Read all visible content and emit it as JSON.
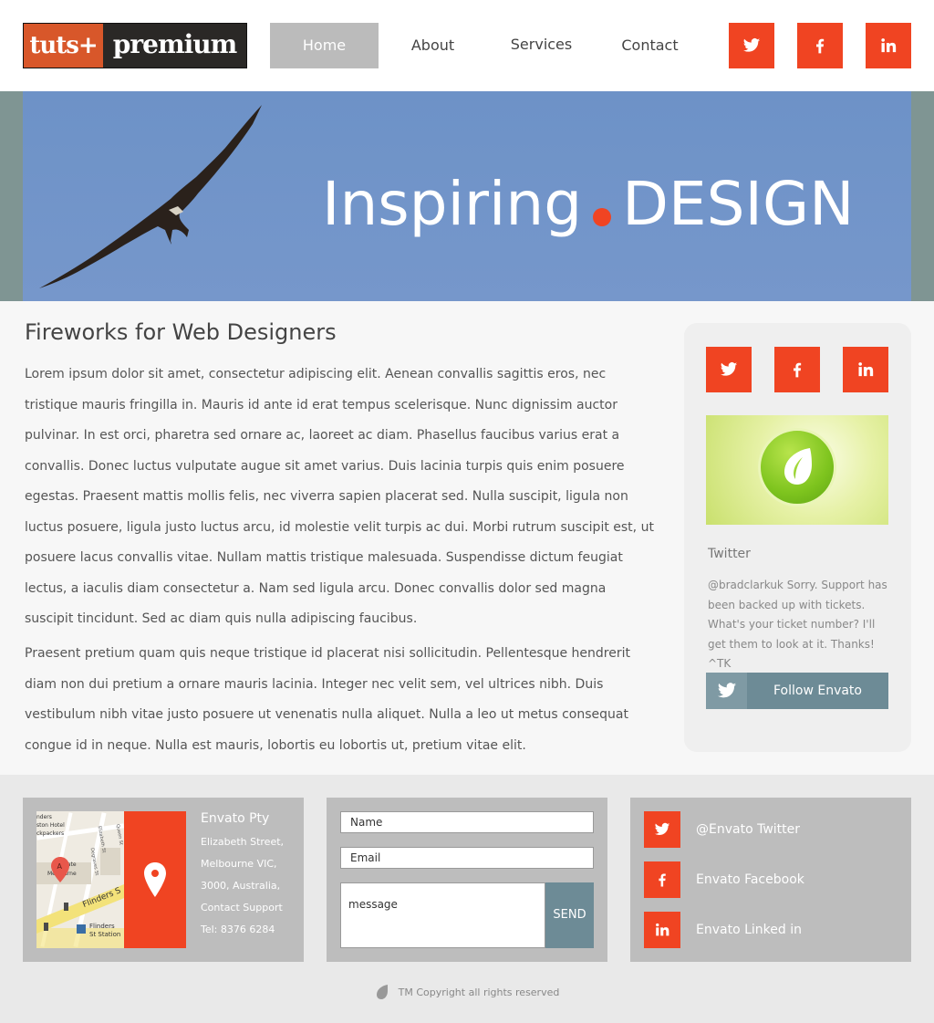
{
  "logo": {
    "part1": "tuts+",
    "part2": "premium"
  },
  "nav": {
    "items": [
      {
        "label": "Home",
        "active": true
      },
      {
        "label": "About",
        "active": false
      },
      {
        "label": "Services",
        "active": false
      },
      {
        "label": "Contact",
        "active": false
      }
    ]
  },
  "header_social": [
    "twitter-icon",
    "facebook-icon",
    "linkedin-icon"
  ],
  "hero": {
    "title_left": "Inspiring",
    "title_right": "DESIGN"
  },
  "article": {
    "title": "Fireworks for Web Designers",
    "paragraphs": [
      "Lorem ipsum dolor sit amet, consectetur adipiscing elit. Aenean convallis sagittis eros, nec tristique mauris fringilla in. Mauris id ante id erat tempus scelerisque. Nunc dignissim auctor pulvinar. In est orci, pharetra sed ornare ac, laoreet ac diam. Phasellus faucibus varius erat a convallis. Donec luctus vulputate augue sit amet varius. Duis lacinia turpis quis enim posuere egestas. Praesent mattis mollis felis, nec viverra sapien placerat sed. Nulla suscipit, ligula non luctus posuere, ligula justo luctus arcu, id molestie velit turpis ac dui. Morbi rutrum suscipit est, ut posuere lacus convallis vitae. Nullam mattis tristique malesuada. Suspendisse dictum feugiat lectus, a iaculis diam consectetur a. Nam sed ligula arcu. Donec convallis dolor sed magna suscipit tincidunt. Sed ac diam quis nulla adipiscing faucibus.",
      "Praesent pretium quam quis neque tristique id placerat nisi sollicitudin. Pellentesque hendrerit diam non dui pretium a ornare mauris lacinia. Integer nec velit sem, vel ultrices nibh. Duis vestibulum nibh vitae justo posuere ut venenatis nulla aliquet. Nulla a leo ut metus consequat congue id in neque. Nulla est mauris, lobortis eu lobortis ut, pretium vitae elit."
    ]
  },
  "sidebar": {
    "twitter_title": "Twitter",
    "tweet": "@bradclarkuk Sorry. Support has been backed up with tickets. What's your ticket number? I'll get them to look at it. Thanks! ^TK",
    "follow_label": "Follow Envato"
  },
  "footer": {
    "address": {
      "title": "Envato Pty",
      "lines": [
        "Elizabeth Street,",
        "Melbourne VIC,",
        "3000, Australia,",
        "Contact Support",
        "Tel: 8376 6284"
      ]
    },
    "map_labels": [
      "nders",
      "ston Hotel",
      "ckpackers",
      "gate",
      "Melbourne",
      "Flinders S",
      "Flinders",
      "St Station",
      "Elizabeth St",
      "Queen St",
      "Degraves St",
      "A"
    ],
    "form": {
      "name_placeholder": "Name",
      "email_placeholder": "Email",
      "message_placeholder": "message",
      "send_label": "SEND"
    },
    "links": [
      {
        "icon": "twitter-icon",
        "label": "@Envato Twitter"
      },
      {
        "icon": "facebook-icon",
        "label": "Envato Facebook"
      },
      {
        "icon": "linkedin-icon",
        "label": "Envato Linked in"
      }
    ],
    "copyright": "TM Copyright all rights reserved"
  },
  "colors": {
    "accent": "#f04422",
    "slate": "#6d8b96",
    "nav_active": "#bbbbbb",
    "hero_sky": "#7697cb"
  }
}
